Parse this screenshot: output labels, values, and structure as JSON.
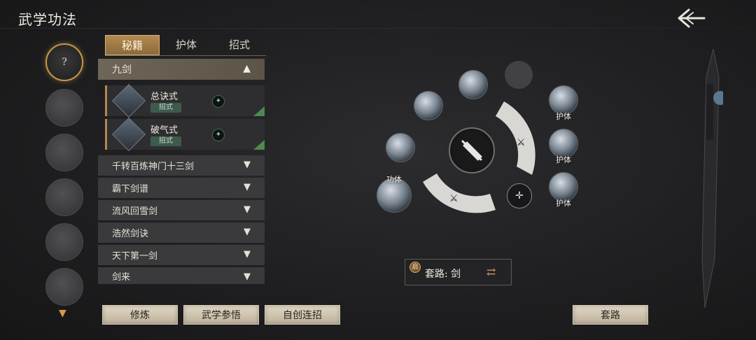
{
  "header": {
    "title": "武学功法"
  },
  "slots": {
    "active_mark": "?"
  },
  "tabs": [
    {
      "label": "秘籍",
      "active": true
    },
    {
      "label": "护体",
      "active": false
    },
    {
      "label": "招式",
      "active": false
    }
  ],
  "list": {
    "open_category": "九剑",
    "skills": [
      {
        "name": "总诀式",
        "tag": "招式"
      },
      {
        "name": "破气式",
        "tag": "招式"
      }
    ],
    "categories": [
      "千转百炼神门十三剑",
      "霸下剑谱",
      "流风回雪剑",
      "浩然剑诀",
      "天下第一剑",
      "剑来"
    ]
  },
  "buttons": {
    "practice": "修炼",
    "study": "武学参悟",
    "create_combo": "自创连招",
    "routine": "套路"
  },
  "wheel": {
    "labels": {
      "gongti": "功体",
      "huti": "护体"
    }
  },
  "routine_box": {
    "badge": "启",
    "text": "套路: 剑"
  },
  "colors": {
    "accent": "#c8974a",
    "tab_active": "#b38a50",
    "check": "#4d8a52"
  }
}
